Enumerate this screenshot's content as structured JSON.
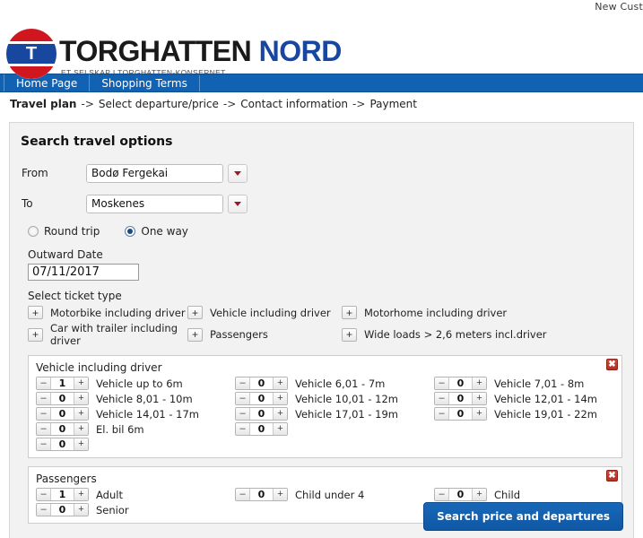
{
  "topbar": {
    "new_customer_text": "New Cust"
  },
  "logo": {
    "mark_letter": "T",
    "name_main": "TORGHATTEN",
    "name_accent": "NORD",
    "tagline": "ET SELSKAP I TORGHATTEN-KONSERNET",
    "blue": "#17479e",
    "red": "#d0161f"
  },
  "nav": {
    "items": [
      {
        "label": "Home Page"
      },
      {
        "label": "Shopping Terms"
      }
    ],
    "background": "#1262b3"
  },
  "breadcrumb": {
    "sep": "->",
    "steps": [
      {
        "label": "Travel plan",
        "active": true
      },
      {
        "label": "Select departure/price",
        "active": false
      },
      {
        "label": "Contact information",
        "active": false
      },
      {
        "label": "Payment",
        "active": false
      }
    ]
  },
  "search_panel": {
    "title": "Search travel options",
    "from": {
      "label": "From",
      "value": "Bodø Fergekai"
    },
    "to": {
      "label": "To",
      "value": "Moskenes"
    },
    "trip_type": {
      "round_trip": {
        "label": "Round trip",
        "selected": false
      },
      "one_way": {
        "label": "One way",
        "selected": true
      }
    },
    "outward_date": {
      "label": "Outward Date",
      "value": "07/11/2017"
    },
    "ticket_type": {
      "label": "Select ticket type",
      "plus": "+",
      "items": [
        {
          "label": "Motorbike including driver"
        },
        {
          "label": "Vehicle including driver"
        },
        {
          "label": "Motorhome including driver"
        },
        {
          "label": "Car with trailer including driver"
        },
        {
          "label": "Passengers"
        },
        {
          "label": "Wide loads > 2,6 meters incl.driver"
        }
      ]
    },
    "groups": [
      {
        "title": "Vehicle including driver",
        "close_icon": "✖",
        "rows": [
          [
            {
              "value": "1",
              "label": "Vehicle up to 6m"
            },
            {
              "value": "0",
              "label": "Vehicle 6,01 - 7m"
            },
            {
              "value": "0",
              "label": "Vehicle 7,01 - 8m"
            }
          ],
          [
            {
              "value": "0",
              "label": "Vehicle 8,01 - 10m"
            },
            {
              "value": "0",
              "label": "Vehicle 10,01 - 12m"
            },
            {
              "value": "0",
              "label": "Vehicle 12,01 - 14m"
            }
          ],
          [
            {
              "value": "0",
              "label": "Vehicle 14,01 - 17m"
            },
            {
              "value": "0",
              "label": "Vehicle 17,01 - 19m"
            },
            {
              "value": "0",
              "label": "Vehicle 19,01 - 22m"
            }
          ],
          [
            {
              "value": "0",
              "label": "El. bil 6m"
            },
            {
              "value": "0",
              "label": ""
            }
          ],
          [
            {
              "value": "0",
              "label": ""
            }
          ]
        ]
      },
      {
        "title": "Passengers",
        "close_icon": "✖",
        "rows": [
          [
            {
              "value": "1",
              "label": "Adult"
            },
            {
              "value": "0",
              "label": "Child under 4"
            },
            {
              "value": "0",
              "label": "Child"
            }
          ],
          [
            {
              "value": "0",
              "label": "Senior"
            }
          ]
        ]
      }
    ],
    "stepper": {
      "minus": "–",
      "plus": "+"
    },
    "submit_label": "Search price and departures",
    "submit_color": "#1262b3"
  }
}
